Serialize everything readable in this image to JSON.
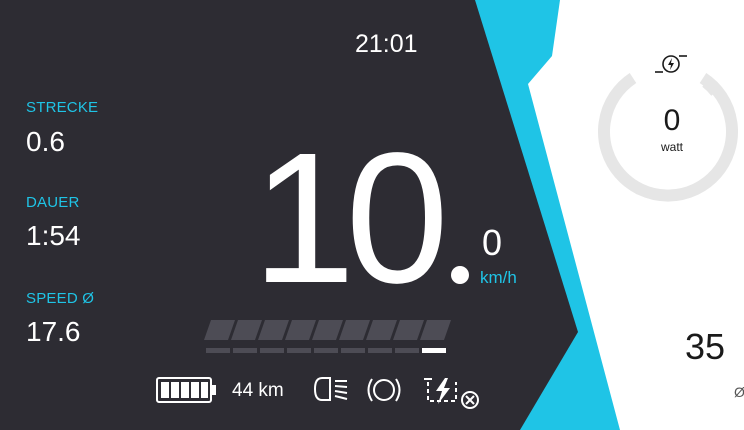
{
  "clock": {
    "time": "21:01"
  },
  "trip": {
    "distance": {
      "label": "STRECKE",
      "value": "0.6"
    },
    "duration": {
      "label": "DAUER",
      "value": "1:54"
    },
    "avg_speed": {
      "label": "SPEED Ø",
      "value": "17.6"
    }
  },
  "speed": {
    "integer": "10",
    "decimal": "0",
    "unit": "km/h"
  },
  "assist_bar": {
    "segments_total": 9,
    "segments_active": 1
  },
  "status": {
    "battery_icon": "battery-icon",
    "battery_level": 1.0,
    "range": "44 km",
    "light_icon": "headlight-icon",
    "brake_icon": "brake-icon",
    "charge_icon": "charging-disabled-icon"
  },
  "power": {
    "value": "0",
    "unit": "watt",
    "icon": "motor-icon"
  },
  "cadence": {
    "value": "35",
    "symbol": "Ø"
  },
  "colors": {
    "panel": "#2d2c33",
    "accent": "#1fc4e6",
    "gauge": "#e6e6e6",
    "white": "#ffffff"
  }
}
